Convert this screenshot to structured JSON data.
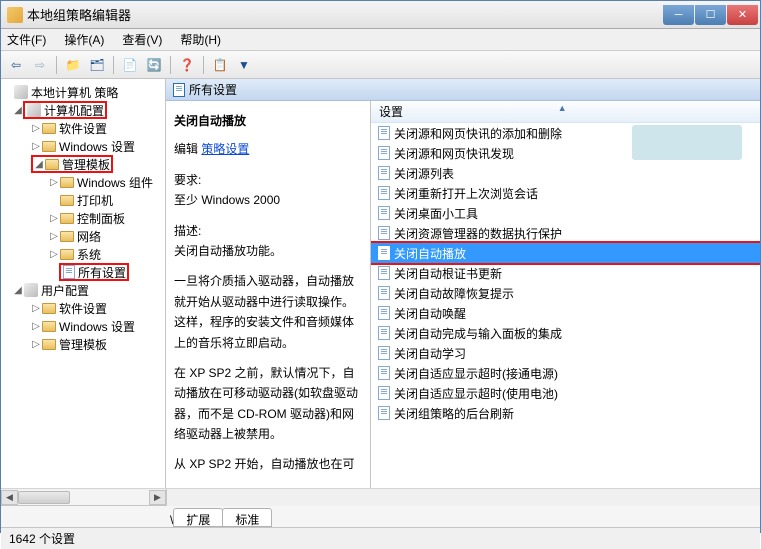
{
  "window": {
    "title": "本地组策略编辑器"
  },
  "menu": {
    "file": "文件(F)",
    "action": "操作(A)",
    "view": "查看(V)",
    "help": "帮助(H)"
  },
  "tree": {
    "root": "本地计算机 策略",
    "computer_config": "计算机配置",
    "software_settings": "软件设置",
    "windows_settings": "Windows 设置",
    "admin_templates": "管理模板",
    "windows_components": "Windows 组件",
    "printers": "打印机",
    "control_panel": "控制面板",
    "network": "网络",
    "system": "系统",
    "all_settings": "所有设置",
    "user_config": "用户配置",
    "u_software": "软件设置",
    "u_windows": "Windows 设置",
    "u_admin": "管理模板"
  },
  "content_header": "所有设置",
  "description": {
    "title": "关闭自动播放",
    "action_label": "编辑",
    "link": "策略设置",
    "req_label": "要求:",
    "req_value": "至少 Windows 2000",
    "desc_label": "描述:",
    "desc_value": "关闭自动播放功能。",
    "para1": "一旦将介质插入驱动器，自动播放就开始从驱动器中进行读取操作。这样，程序的安装文件和音频媒体上的音乐将立即启动。",
    "para2": "在 XP SP2 之前，默认情况下，自动播放在可移动驱动器(如软盘驱动器，而不是 CD-ROM 驱动器)和网络驱动器上被禁用。",
    "para3": "从 XP SP2 开始，自动播放也在可"
  },
  "list": {
    "header": "设置",
    "items": [
      "关闭源和网页快讯的添加和删除",
      "关闭源和网页快讯发现",
      "关闭源列表",
      "关闭重新打开上次浏览会话",
      "关闭桌面小工具",
      "关闭资源管理器的数据执行保护",
      "关闭自动播放",
      "关闭自动根证书更新",
      "关闭自动故障恢复提示",
      "关闭自动唤醒",
      "关闭自动完成与输入面板的集成",
      "关闭自动学习",
      "关闭自适应显示超时(接通电源)",
      "关闭自适应显示超时(使用电池)",
      "关闭组策略的后台刷新"
    ],
    "selected_index": 6
  },
  "tabs": {
    "extended": "扩展",
    "standard": "标准"
  },
  "statusbar": "1642 个设置"
}
